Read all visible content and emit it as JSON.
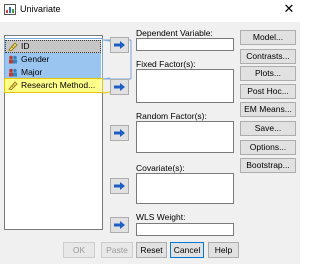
{
  "window": {
    "title": "Univariate",
    "close_glyph": "✕"
  },
  "variables": [
    {
      "label": "ID",
      "icon": "ruler-scale-icon",
      "state": "selected-focused"
    },
    {
      "label": "Gender",
      "icon": "nominal-people-icon",
      "state": "selected"
    },
    {
      "label": "Major",
      "icon": "nominal-people-icon",
      "state": "selected"
    },
    {
      "label": "Research Method...",
      "icon": "ruler-scale-icon",
      "state": "highlighted"
    }
  ],
  "fields": {
    "dependent_variable": "Dependent Variable:",
    "fixed_factors": "Fixed Factor(s):",
    "random_factors": "Random Factor(s):",
    "covariates": "Covariate(s):",
    "wls_weight": "WLS Weight:"
  },
  "side_buttons": {
    "model": "Model...",
    "contrasts": "Contrasts...",
    "plots": "Plots...",
    "post_hoc": "Post Hoc...",
    "em_means": "EM Means...",
    "save": "Save...",
    "options": "Options...",
    "bootstrap": "Bootstrap..."
  },
  "bottom_buttons": {
    "ok": "OK",
    "paste": "Paste",
    "reset": "Reset",
    "cancel": "Cancel",
    "help": "Help"
  },
  "colors": {
    "selection_blue": "#99c5f0",
    "highlight_yellow": "#ffff8a",
    "arrow_blue": "#1f5fc4",
    "focus_border": "#0078d7"
  }
}
